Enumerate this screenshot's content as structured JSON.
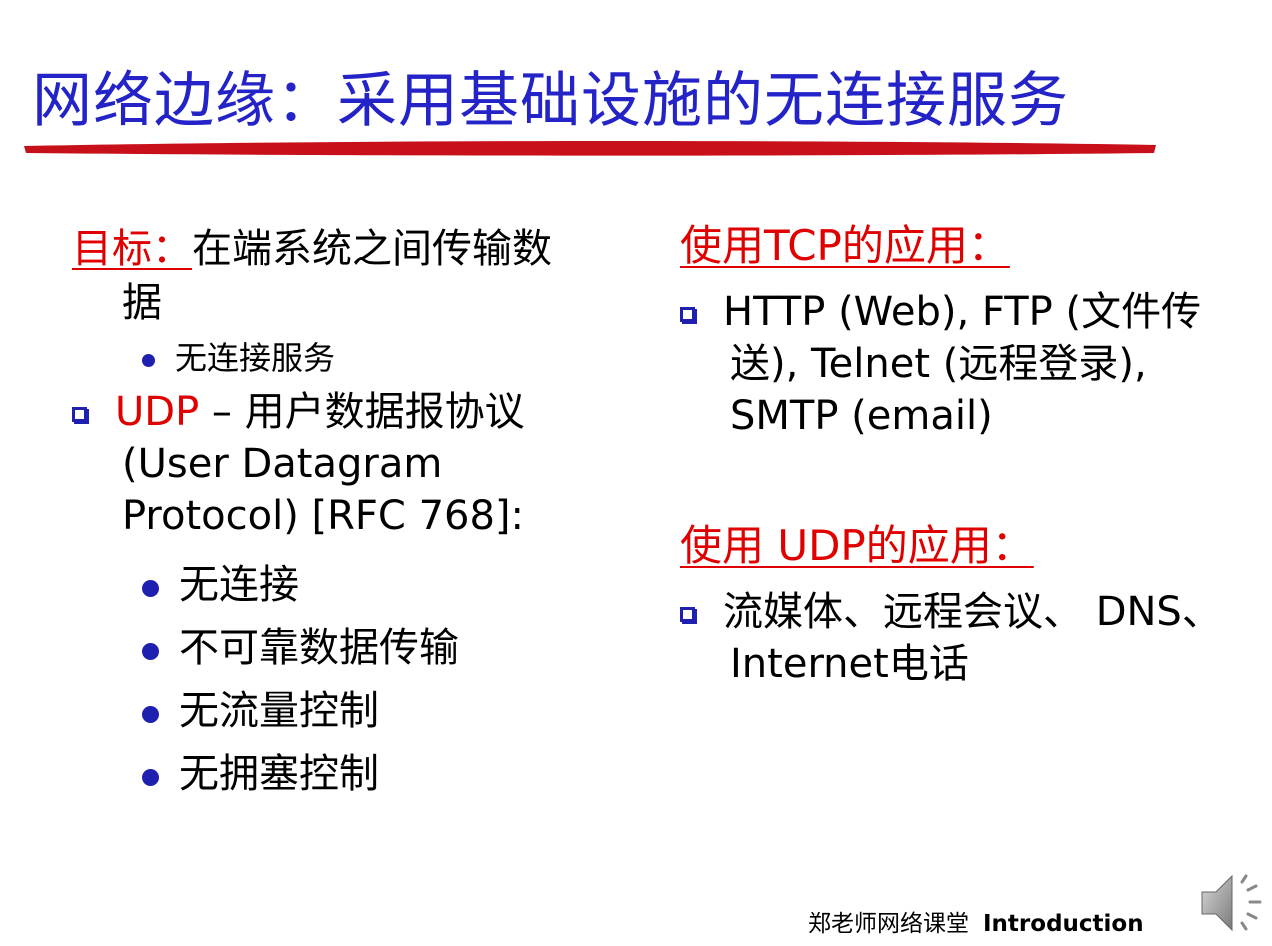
{
  "title": "网络边缘：采用基础设施的无连接服务",
  "left": {
    "goal_label": "目标：",
    "goal_text_1": "在端系统之间传输数",
    "goal_text_2": "据",
    "goal_sub": "无连接服务",
    "udp_name": "UDP",
    "udp_dash": " – 用户数据报协议",
    "udp_line2": "(User Datagram",
    "udp_line3": "Protocol) [RFC 768]:",
    "features": [
      "无连接",
      "不可靠数据传输",
      "无流量控制",
      "无拥塞控制"
    ]
  },
  "right": {
    "tcp_heading": "使用TCP的应用：",
    "tcp_line1": "HTTP (Web), FTP (文件传",
    "tcp_line2": "送), Telnet (远程登录),",
    "tcp_line3": "SMTP (email)",
    "udp_heading": "使用 UDP的应用：",
    "udp_line1": "流媒体、远程会议、 DNS、",
    "udp_line2": "Internet电话"
  },
  "footer": {
    "channel": "郑老师网络课堂",
    "section": "Introduction"
  },
  "icons": {
    "speaker": "speaker-icon"
  },
  "colors": {
    "title": "#2323c8",
    "accent_red": "#e00000",
    "bullet_blue": "#1f1fb0",
    "title_rule": "#c8101a"
  }
}
